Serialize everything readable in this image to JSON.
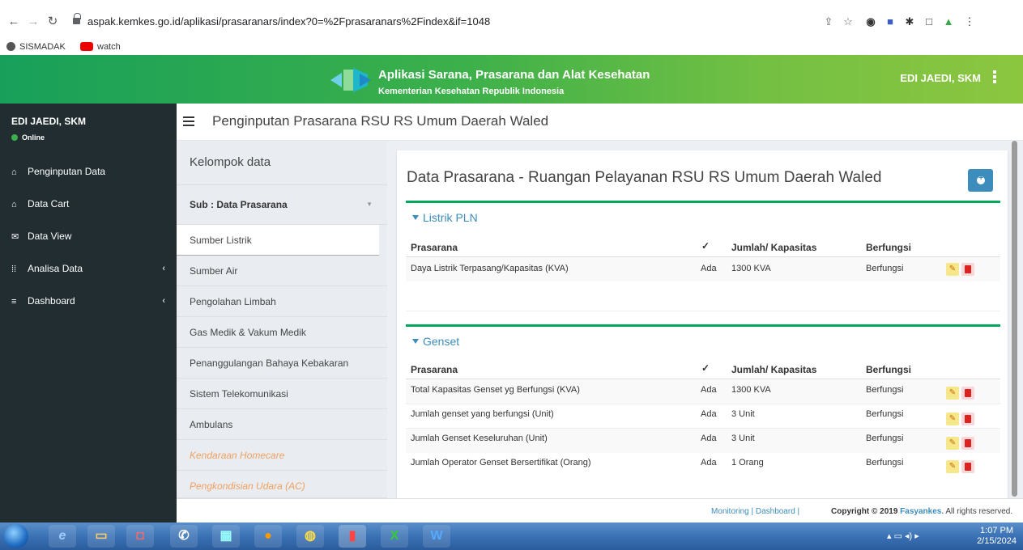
{
  "browser": {
    "url": "aspak.kemkes.go.id/aplikasi/prasaranars/index?0=%2Fprasaranars%2Findex&if=1048",
    "bookmarks": [
      "SISMADAK",
      "watch"
    ]
  },
  "topbar": {
    "title": "Aplikasi Sarana, Prasarana dan Alat Kesehatan",
    "subtitle": "Kementerian Kesehatan Republik Indonesia",
    "user": "EDI JAEDI, SKM"
  },
  "sidebar": {
    "user": "EDI JAEDI, SKM",
    "status": "Online",
    "items": [
      {
        "label": "Penginputan Data",
        "icon": "home-icon"
      },
      {
        "label": "Data Cart",
        "icon": "home-icon"
      },
      {
        "label": "Data View",
        "icon": "envelope-icon"
      },
      {
        "label": "Analisa Data",
        "icon": "grid-icon"
      },
      {
        "label": "Dashboard",
        "icon": "list-icon"
      }
    ]
  },
  "header": {
    "title": "Penginputan Prasarana RSU RS Umum Daerah Waled"
  },
  "kelompok": {
    "title": "Kelompok data",
    "sub": "Sub : Data Prasarana",
    "items": [
      "Sumber Listrik",
      "Sumber Air",
      "Pengolahan Limbah",
      "Gas Medik & Vakum Medik",
      "Penanggulangan Bahaya Kebakaran",
      "Sistem Telekomunikasi",
      "Ambulans",
      "Kendaraan Homecare",
      "Pengkondisian Udara (AC)"
    ]
  },
  "panel": {
    "title": "Data Prasarana - Ruangan Pelayanan RSU RS Umum Daerah Waled",
    "columns": [
      "Prasarana",
      "✓",
      "Jumlah/ Kapasitas",
      "Berfungsi"
    ],
    "sections": [
      {
        "title": "Listrik PLN",
        "rows": [
          [
            "Daya Listrik Terpasang/Kapasitas (KVA)",
            "Ada",
            "1300 KVA",
            "Berfungsi"
          ]
        ]
      },
      {
        "title": "Genset",
        "rows": [
          [
            "Total Kapasitas Genset yg Berfungsi (KVA)",
            "Ada",
            "1300 KVA",
            "Berfungsi"
          ],
          [
            "Jumlah genset yang berfungsi (Unit)",
            "Ada",
            "3 Unit",
            "Berfungsi"
          ],
          [
            "Jumlah Genset Keseluruhan (Unit)",
            "Ada",
            "3 Unit",
            "Berfungsi"
          ],
          [
            "Jumlah Operator Genset Bersertifikat (Orang)",
            "Ada",
            "1 Orang",
            "Berfungsi"
          ]
        ]
      }
    ]
  },
  "footer": {
    "links": "Monitoring | Dashboard |",
    "copyright_prefix": "Copyright © 2019",
    "brand": "Fasyankes.",
    "copyright_suffix": "All rights reserved."
  },
  "taskbar": {
    "time": "1:07 PM",
    "date": "2/15/2024"
  }
}
